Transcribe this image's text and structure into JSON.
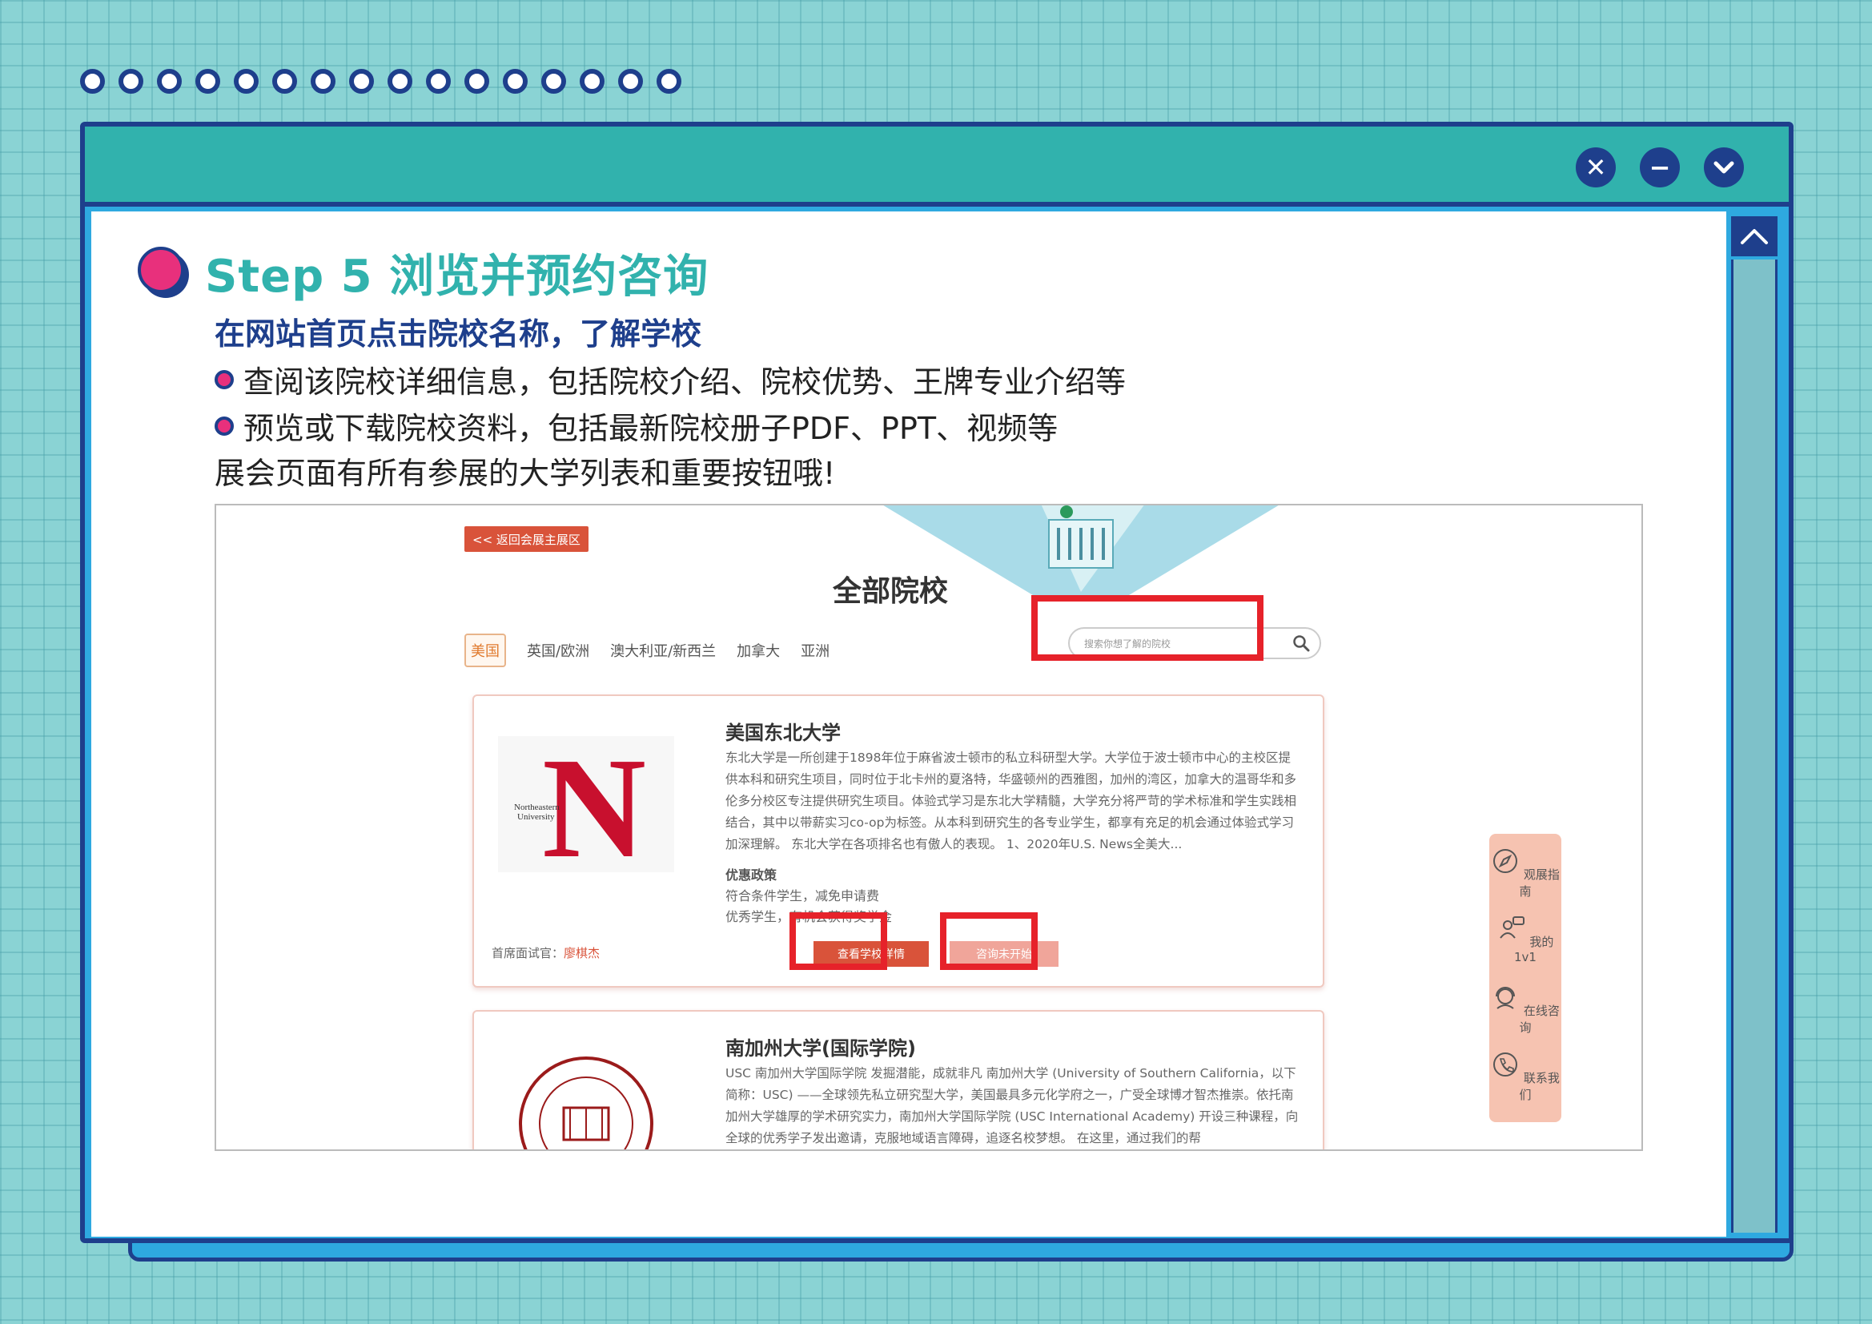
{
  "dots_count": 16,
  "window": {
    "buttons": [
      {
        "name": "close-icon",
        "glyph": "✕"
      },
      {
        "name": "minimize-icon",
        "glyph": "−"
      },
      {
        "name": "chevron-down-icon",
        "glyph": "⌄"
      }
    ]
  },
  "step": {
    "title": "Step 5 浏览并预约咨询",
    "subtitle": "在网站首页点击院校名称，了解学校",
    "bullet1": "查阅该院校详细信息，包括院校介绍、院校优势、王牌专业介绍等",
    "bullet2": "预览或下载院校资料，包括最新院校册子PDF、PPT、视频等",
    "note": "展会页面有所有参展的大学列表和重要按钮哦!"
  },
  "site": {
    "back_label": "<< 返回会展主展区",
    "page_title": "全部院校",
    "tabs": [
      "美国",
      "英国/欧洲",
      "澳大利亚/新西兰",
      "加拿大",
      "亚洲"
    ],
    "search_placeholder": "搜索你想了解的院校",
    "card1": {
      "name": "美国东北大学",
      "logo_caption_1": "Northeastern",
      "logo_caption_2": "University",
      "desc": "东北大学是一所创建于1898年位于麻省波士顿市的私立科研型大学。大学位于波士顿市中心的主校区提供本科和研究生项目，同时位于北卡州的夏洛特，华盛顿州的西雅图，加州的湾区，加拿大的温哥华和多伦多分校区专注提供研究生项目。体验式学习是东北大学精髓，大学充分将严苛的学术标准和学生实践相结合，其中以带薪实习co-op为标签。从本科到研究生的各专业学生，都享有充足的机会通过体验式学习加深理解。 东北大学在各项排名也有傲人的表现。 1、2020年U.S. News全美大...",
      "perk_title": "优惠政策",
      "perk1": "符合条件学生，减免申请费",
      "perk2": "优秀学生，有机会获得奖学金",
      "interviewer_label": "首席面试官：",
      "interviewer_name": "廖棋杰",
      "detail_btn": "查看学校详情",
      "consult_btn": "咨询未开始"
    },
    "card2": {
      "name": "南加州大学(国际学院)",
      "desc": "USC 南加州大学国际学院 发掘潜能，成就非凡 南加州大学 (University of Southern California，以下简称：USC) ——全球领先私立研究型大学，美国最具多元化学府之一，广受全球博才智杰推崇。依托南加州大学雄厚的学术研究实力，南加州大学国际学院 (USC International Academy) 开设三种课程，向全球的优秀学子发出邀请，克服地域语言障碍，追逐名校梦想。 在这里，通过我们的帮"
    },
    "float_menu": [
      "观展指南",
      "我的1v1",
      "在线咨询",
      "联系我们"
    ]
  },
  "colors": {
    "navy": "#1e3f8c",
    "teal": "#31b2ad",
    "pink": "#e8307c",
    "highlight_red": "#e6222a",
    "button_red": "#d9533a"
  }
}
